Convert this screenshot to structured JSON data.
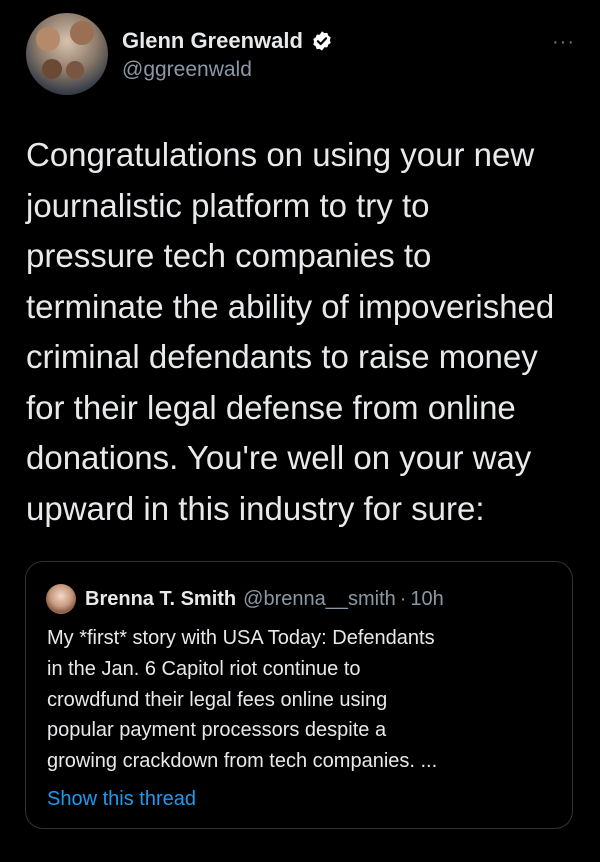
{
  "tweet": {
    "author_name": "Glenn Greenwald",
    "author_handle": "@ggreenwald",
    "more_label": "···",
    "text": "Congratulations on using your new\njournalistic platform to try to\npressure tech companies to\nterminate the ability of impoverished\ncriminal defendants to raise money\nfor their legal defense from online\ndonations. You're well on your way\nupward in this industry for sure:"
  },
  "quote": {
    "author_name": "Brenna T. Smith",
    "author_handle": "@brenna__smith",
    "separator": "·",
    "time": "10h",
    "text": "My *first* story with USA Today: Defendants\nin the Jan. 6 Capitol riot continue to\ncrowdfund their legal fees online using\npopular payment processors despite a\ngrowing crackdown from tech companies. ...",
    "link_label": "Show this thread"
  },
  "colors": {
    "background": "#000000",
    "text": "#e7e9ea",
    "secondary": "#8b98a5",
    "link": "#1d9bf0",
    "border": "#2f3336"
  },
  "icons": [
    "verified-badge-icon",
    "more-options-icon"
  ]
}
